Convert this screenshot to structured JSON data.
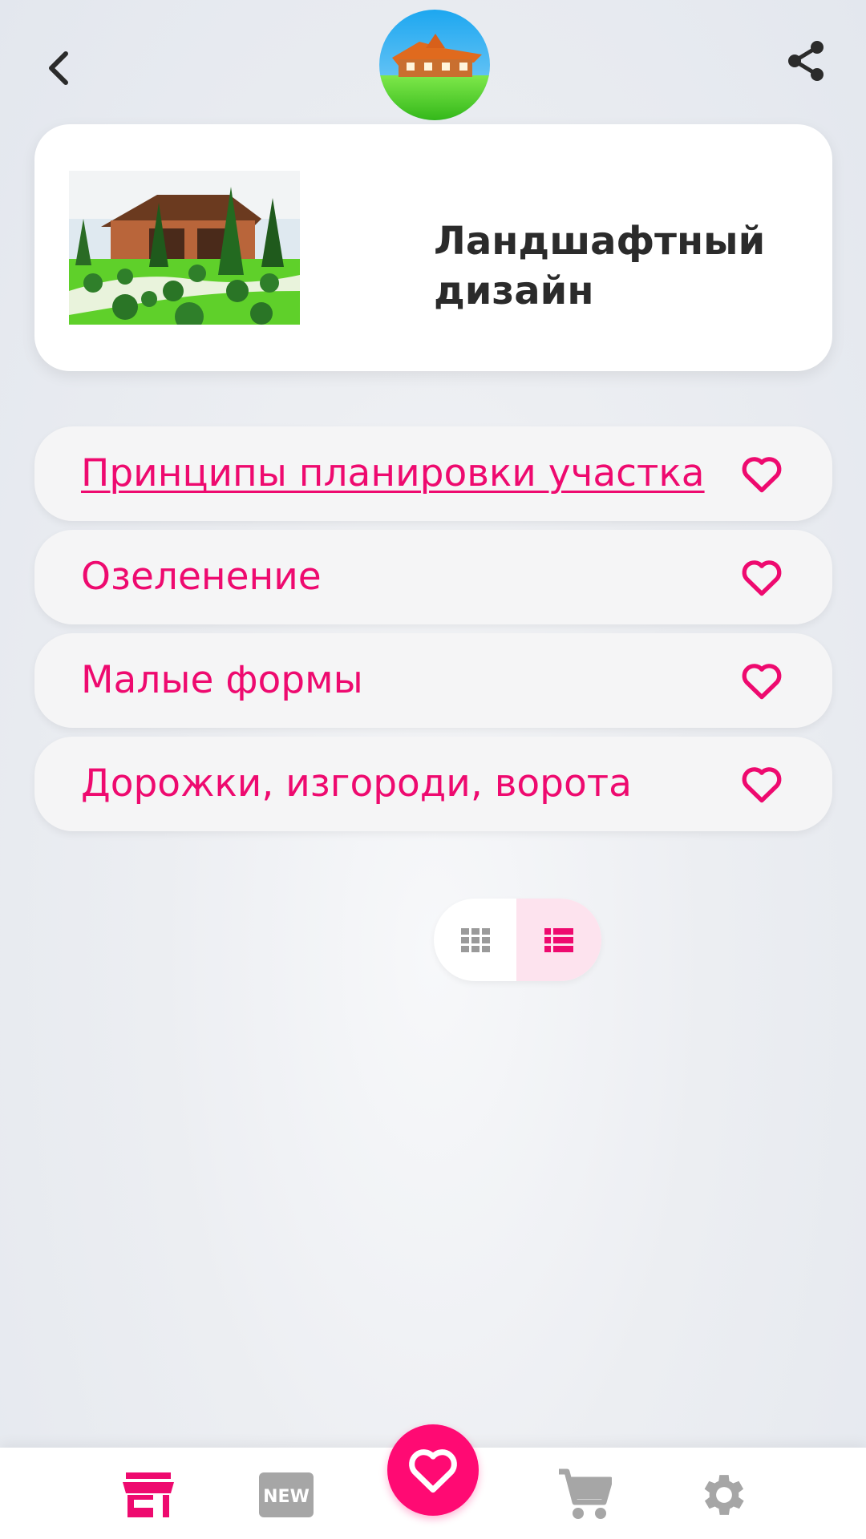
{
  "topbar": {
    "back_icon": "chevron-left-icon",
    "share_icon": "share-icon",
    "logo": "house-logo"
  },
  "header": {
    "title": "Ландшафтный дизайн",
    "image": "garden-photo"
  },
  "list": {
    "items": [
      {
        "label": "Принципы планировки участка",
        "underlined": true
      },
      {
        "label": "Озеленение",
        "underlined": false
      },
      {
        "label": "Малые формы",
        "underlined": false
      },
      {
        "label": "Дорожки, изгороди, ворота",
        "underlined": false
      }
    ]
  },
  "view_toggle": {
    "options": [
      "grid",
      "list"
    ],
    "selected": "list"
  },
  "bottom_nav": {
    "items": [
      "store-icon",
      "new-icon",
      "heart-icon",
      "cart-icon",
      "gear-icon"
    ],
    "active": "store-icon",
    "new_badge_text": "NEW"
  },
  "colors": {
    "accent": "#ee0a6f",
    "fab": "#ff0a73",
    "inactive_icon": "#a6a6a6",
    "title_text": "#2b2b2b",
    "list_selected_bg": "#fde3ee"
  }
}
